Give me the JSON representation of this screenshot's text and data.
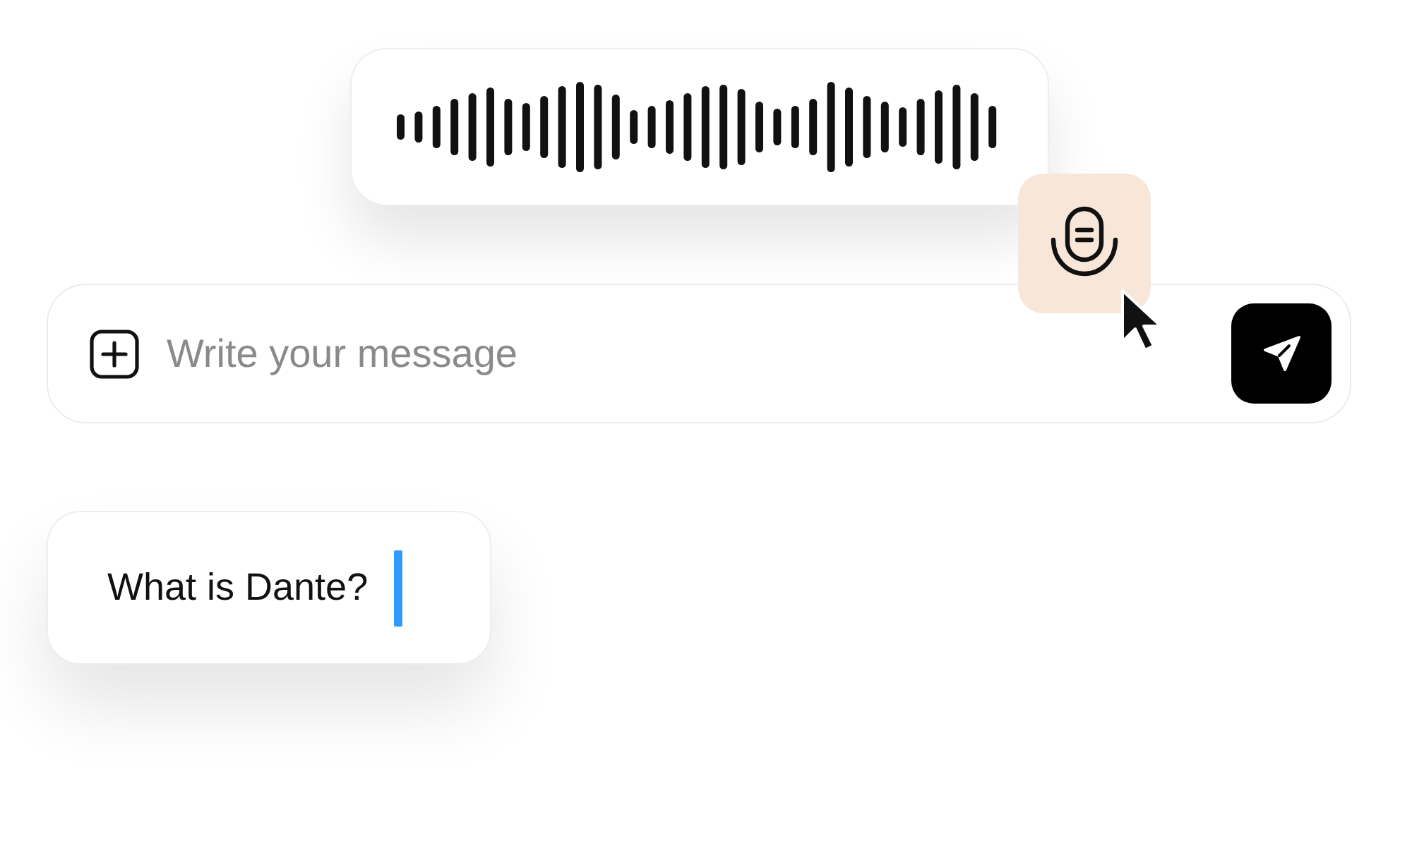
{
  "voice": {
    "recording": true
  },
  "composer": {
    "placeholder": "Write your message"
  },
  "message": {
    "text": "What is Dante?",
    "caret": true
  }
}
